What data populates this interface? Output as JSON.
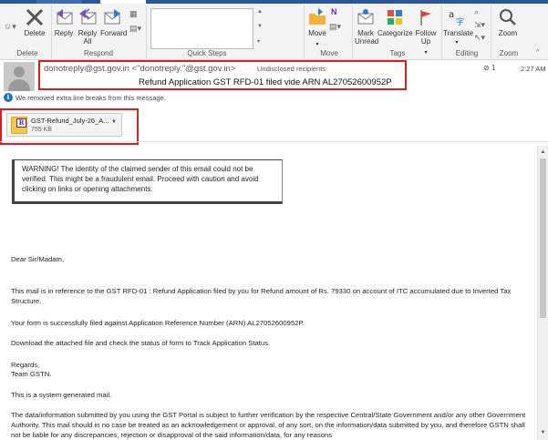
{
  "ribbon": {
    "delete": {
      "label": "Delete",
      "group": "Delete"
    },
    "respond": {
      "reply": "Reply",
      "reply_all": "Reply All",
      "forward": "Forward",
      "group": "Respond"
    },
    "quick_steps": {
      "group": "Quick Steps"
    },
    "move": {
      "label": "Move",
      "group": "Move"
    },
    "tags": {
      "mark_unread": "Mark Unread",
      "categorize": "Categorize",
      "follow_up": "Follow Up",
      "group": "Tags"
    },
    "editing": {
      "translate": "Translate",
      "group": "Editing"
    },
    "zoom": {
      "label": "Zoom",
      "group": "Zoom"
    }
  },
  "message": {
    "from": "donotreply@gst.gov.in <\"donotreply.\"@gst.gov.in>",
    "to": "Undisclosed recipients:",
    "subject": "Refund Application GST RFD-01 filed vide ARN AL27052600952P",
    "attachment_count": "1",
    "time": "2:27 AM",
    "info": "We removed extra line breaks from this message."
  },
  "attachment": {
    "name": "GST-Refund_July-26_A...",
    "size": "755 KB"
  },
  "body": {
    "warning": "WARNING! The identity of the claimed sender of this email could not be verified. This might be a fraudulent email. Proceed with caution and avoid clicking on links or opening attachments.",
    "greeting": "Dear Sir/Madam,",
    "p1": "This mail is in reference to the  GST RFD-01 : Refund Application filed by you for Refund amount of Rs.  79330  on account of ITC accumulated due to Inverted Tax Structure.",
    "p2": "Your form is successfully filed against Application Reference Number (ARN) AL27052600952P.",
    "p3": "Download the attached file and check the status of form to Track Application Status.",
    "regards": "Regards,",
    "team": "Team GSTN.",
    "p4": "This is a system generated mail.",
    "p5": "The data/information submitted by you using the GST Portal is subject to further verification by the respective Central/State Government and/or any other Government Authority. This mail should in no case be treated as an acknowledgement or approval, of any sort, on the information/data submitted by you, and therefore GSTN shall not be liable for any discrepancies, rejection or disapproval of the said information/data, for any reasons"
  },
  "colors": {
    "accent": "#2b579a",
    "highlight_red": "#e11b22"
  }
}
